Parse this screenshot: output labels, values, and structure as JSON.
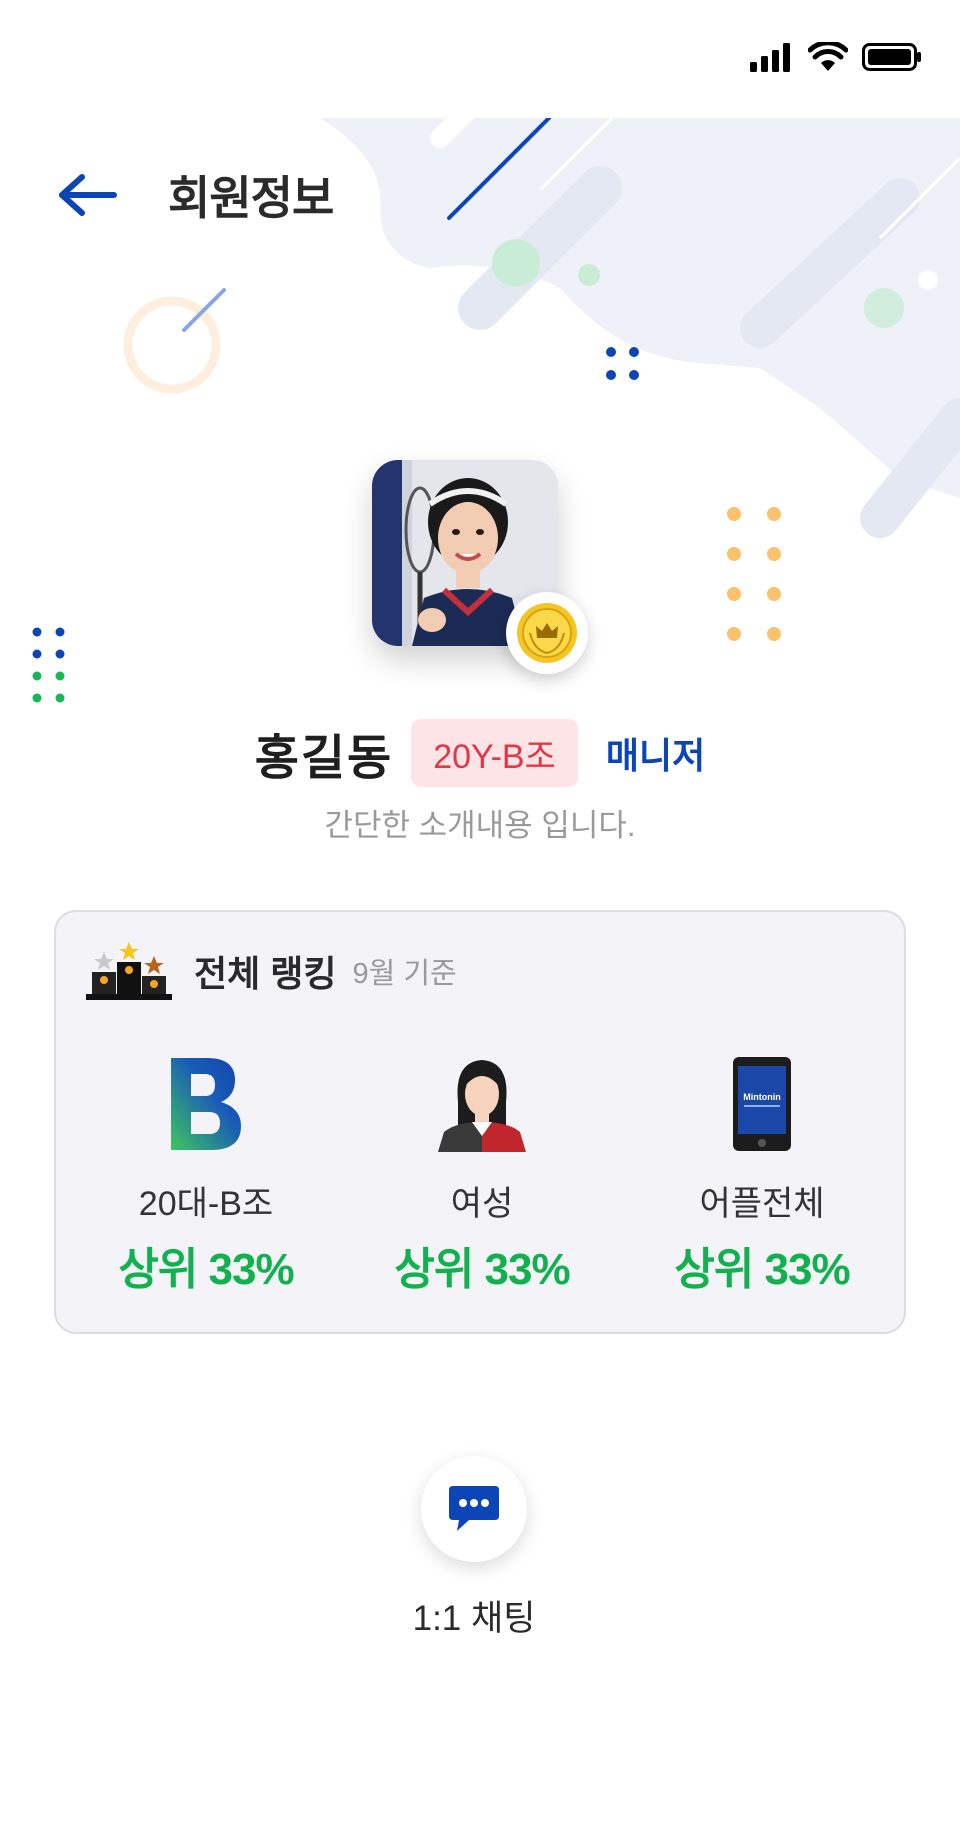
{
  "status_bar": {
    "icons": [
      "signal-icon",
      "wifi-icon",
      "battery-icon"
    ]
  },
  "header": {
    "title": "회원정보",
    "back_icon": "back-arrow-icon"
  },
  "profile": {
    "name": "홍길동",
    "group_badge": "20Y-B조",
    "role": "매니저",
    "intro": "간단한 소개내용 입니다.",
    "medal_icon": "crown-medal-icon"
  },
  "ranking": {
    "title": "전체 랭킹",
    "subtitle": "9월 기준",
    "items": [
      {
        "icon": "b-grade-icon",
        "label": "20대-B조",
        "value": "상위 33%"
      },
      {
        "icon": "female-avatar-icon",
        "label": "여성",
        "value": "상위 33%"
      },
      {
        "icon": "smartphone-icon",
        "label": "어플전체",
        "value": "상위 33%",
        "icon_text": "Mintonin"
      }
    ]
  },
  "chat": {
    "label": "1:1 채팅",
    "icon": "chat-bubble-icon"
  },
  "colors": {
    "primary": "#0c46b6",
    "badge_bg": "#fde4e6",
    "badge_text": "#e53646",
    "rank_value": "#12b04e",
    "card_bg": "#f3f3f8"
  }
}
